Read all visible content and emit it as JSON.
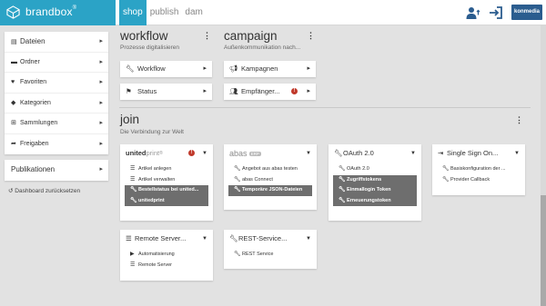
{
  "brand": {
    "name": "brandbox",
    "mark": "®"
  },
  "nav_tabs": [
    {
      "label": "shop",
      "active": true
    },
    {
      "label": "publish",
      "active": false
    },
    {
      "label": "dam",
      "active": false
    }
  ],
  "top_right": {
    "user_icon": "users-icon",
    "logout_icon": "logout-icon",
    "company_logo": "konmedia"
  },
  "sidebar": {
    "header": "Dateien",
    "items": [
      {
        "label": "Ordner",
        "icon": "folder-icon"
      },
      {
        "label": "Favoriten",
        "icon": "heart-icon"
      },
      {
        "label": "Kategorien",
        "icon": "tag-icon"
      },
      {
        "label": "Sammlungen",
        "icon": "cart-icon"
      },
      {
        "label": "Freigaben",
        "icon": "share-icon"
      }
    ],
    "publications": "Publikationen",
    "reset": "Dashboard zurücksetzen"
  },
  "workflow": {
    "title": "workflow",
    "subtitle": "Prozesse digitalisieren",
    "buttons": [
      {
        "label": "Workflow"
      },
      {
        "label": "Status"
      }
    ]
  },
  "campaign": {
    "title": "campaign",
    "subtitle": "Außenkommunikation nach...",
    "buttons": [
      {
        "label": "Kampagnen"
      },
      {
        "label": "Empfänger..."
      }
    ]
  },
  "join": {
    "title": "join",
    "subtitle": "Die Verbindung zur Welt",
    "apps": [
      {
        "title_a": "united",
        "title_b": "print",
        "title_c": "®",
        "items": [
          {
            "label": "Artikel anlegen",
            "highlight": false
          },
          {
            "label": "Artikel verwalten",
            "highlight": false
          },
          {
            "label": "Bestellstatus bei united...",
            "highlight": true
          },
          {
            "label": "unitedprint",
            "highlight": true
          }
        ]
      },
      {
        "title_a": "abas",
        "title_b": "ERP",
        "items": [
          {
            "label": "Angebot aus abas testen",
            "highlight": false
          },
          {
            "label": "abas Connect",
            "highlight": false
          },
          {
            "label": "Temporäre JSON-Dateien",
            "highlight": true
          }
        ]
      },
      {
        "title": "OAuth 2.0",
        "items": [
          {
            "label": "OAuth 2.0",
            "highlight": false
          },
          {
            "label": "Zugriffstokens",
            "highlight": true
          },
          {
            "label": "Einmallogin Token",
            "highlight": true
          },
          {
            "label": "Erneuerungstoken",
            "highlight": true
          }
        ]
      },
      {
        "title": "Single Sign On...",
        "items": [
          {
            "label": "Basiskonfiguration der ...",
            "highlight": false
          },
          {
            "label": "Provider Callback",
            "highlight": false
          }
        ]
      },
      {
        "title": "Remote Server...",
        "items": [
          {
            "label": "Automatisierung",
            "highlight": false
          },
          {
            "label": "Remote Server",
            "highlight": false
          }
        ]
      },
      {
        "title": "REST-Service...",
        "items": [
          {
            "label": "REST Service",
            "highlight": false
          }
        ]
      }
    ]
  }
}
